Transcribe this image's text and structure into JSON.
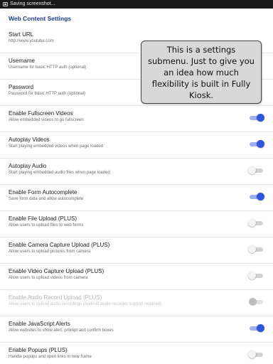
{
  "status_bar": {
    "notification_text": "Saving screenshot..."
  },
  "settings": {
    "section_title": "Web Content Settings",
    "items": [
      {
        "title": "Start URL",
        "summary": "http://www.youtube.com"
      },
      {
        "title": "Username",
        "summary": "Username for basic HTTP auth (optional)"
      },
      {
        "title": "Password",
        "summary": "Password for basic HTTP auth (optional)"
      },
      {
        "title": "Enable Fullscreen Videos",
        "summary": "Allow embedded videos to go fullscreen",
        "state": "on"
      },
      {
        "title": "Autoplay Videos",
        "summary": "Start playing embedded videos when page loaded",
        "state": "on"
      },
      {
        "title": "Autoplay Audio",
        "summary": "Start playing embedded audio files when page loaded",
        "state": "off"
      },
      {
        "title": "Enable Form Autocomplete",
        "summary": "Save form data and allow autocomplete",
        "state": "on"
      },
      {
        "title": "Enable File Upload (PLUS)",
        "summary": "Allow users to upload files to web forms",
        "state": "off"
      },
      {
        "title": "Enable Camera Capture Upload (PLUS)",
        "summary": "Allow users to upload pictures from camera",
        "state": "off"
      },
      {
        "title": "Enable Video Capture Upload (PLUS)",
        "summary": "Allow users to upload videos from camera",
        "state": "off"
      },
      {
        "title": "Enable Audio Record Upload (PLUS)",
        "summary": "Allow users to upload audio recordings (Android audio recorder support required)",
        "state": "disabled"
      },
      {
        "title": "Enable JavaScript Alerts",
        "summary": "Allow websites to show alert, prompt and confirm boxes",
        "state": "on"
      },
      {
        "title": "Enable Popups (PLUS)",
        "summary": "Handle popups and open links in new frame",
        "state": "off"
      }
    ]
  },
  "callout": {
    "text": "This is a settings submenu. Just to give you an idea how much flexibility is built in Fully Kiosk."
  },
  "colors": {
    "section_title": "#1a3e8c",
    "switch_on_thumb": "#2e55e0",
    "switch_on_track": "#9db0f2",
    "callout_background": "#d8d8d8"
  }
}
